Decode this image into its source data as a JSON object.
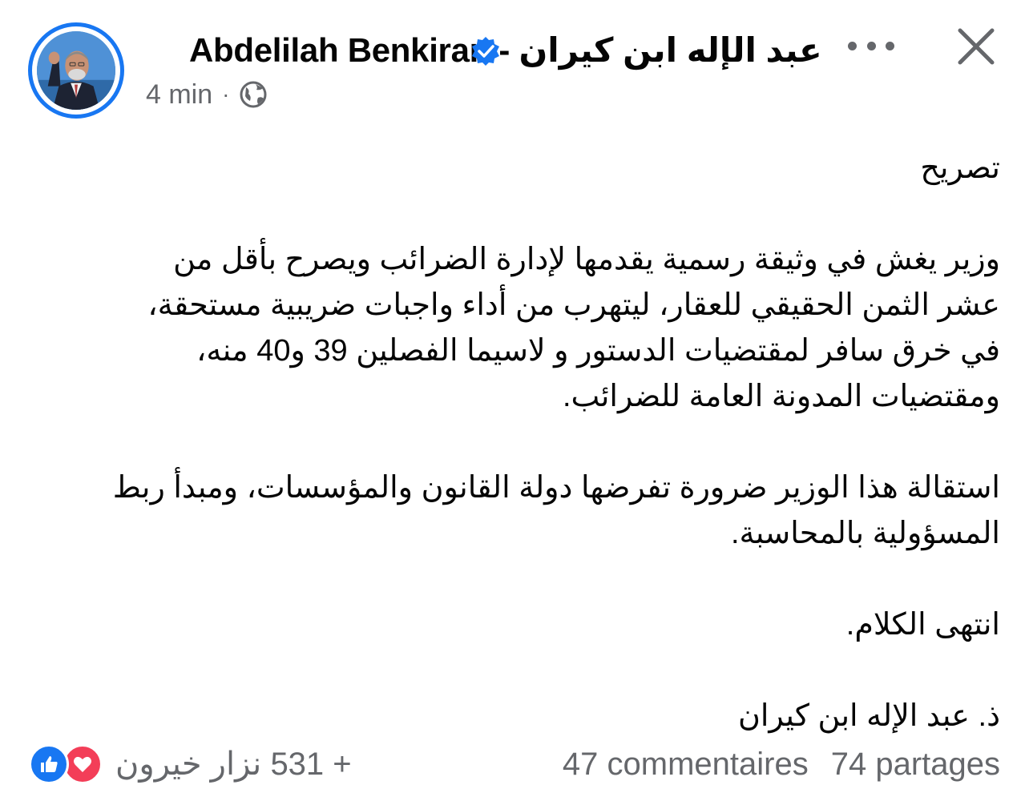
{
  "header": {
    "author_name": "Abdelilah Benkiran - عبد الإله ابن كيران",
    "timestamp": "4 min",
    "separator": "·",
    "privacy_icon": "globe-icon",
    "verified_icon": "verified-badge-icon",
    "more_icon": "more-dots-icon",
    "close_icon": "close-icon"
  },
  "post": {
    "paragraphs": [
      [
        "تصريح"
      ],
      [
        "وزير يغش في وثيقة رسمية يقدمها لإدارة الضرائب ويصرح بأقل من",
        "عشر الثمن الحقيقي للعقار، ليتهرب من أداء واجبات ضريبية مستحقة،",
        "في خرق سافر لمقتضيات الدستور و لاسيما الفصلين 39 و40 منه،",
        "ومقتضيات المدونة العامة للضرائب."
      ],
      [
        "استقالة هذا الوزير ضرورة تفرضها دولة القانون والمؤسسات، ومبدأ ربط",
        "المسؤولية بالمحاسبة."
      ],
      [
        "انتهى الكلام."
      ],
      [
        "ذ. عبد الإله ابن كيران"
      ]
    ]
  },
  "footer": {
    "reaction_icons": [
      "like-icon",
      "love-icon"
    ],
    "reaction_name": "نزار خيرون",
    "reaction_count": "531 +",
    "comments": "47 commentaires",
    "shares": "74 partages"
  },
  "colors": {
    "accent": "#1877f2",
    "love": "#f33e58",
    "secondary_text": "#65676b",
    "primary_text": "#050505"
  }
}
